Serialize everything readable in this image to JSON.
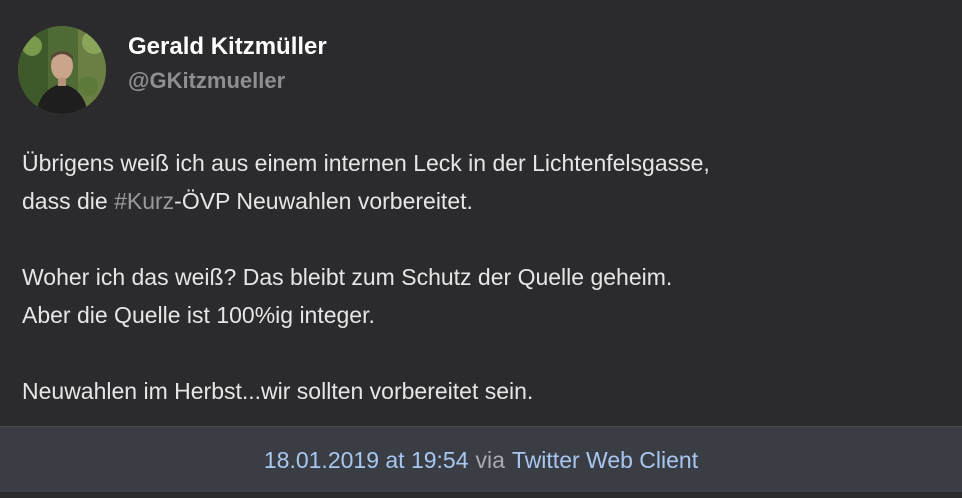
{
  "author": {
    "display_name": "Gerald Kitzmüller",
    "handle": "@GKitzmueller"
  },
  "tweet": {
    "line1": "Übrigens weiß ich aus einem internen Leck in der Lichtenfelsgasse,",
    "line2_pre": "dass die ",
    "line2_hashtag": "#Kurz",
    "line2_post": "-ÖVP Neuwahlen vorbereitet.",
    "line3": "Woher ich das weiß? Das bleibt zum Schutz der Quelle geheim.",
    "line4": "Aber die Quelle ist 100%ig integer.",
    "line5": "Neuwahlen im Herbst...wir sollten vorbereitet sein."
  },
  "footer": {
    "timestamp": "18.01.2019 at 19:54",
    "via": "via",
    "client": "Twitter Web Client"
  },
  "colors": {
    "background": "#2b2b2d",
    "footer_background": "#3a3d44",
    "link": "#a8c7f0",
    "hashtag": "#9a9a9e"
  }
}
